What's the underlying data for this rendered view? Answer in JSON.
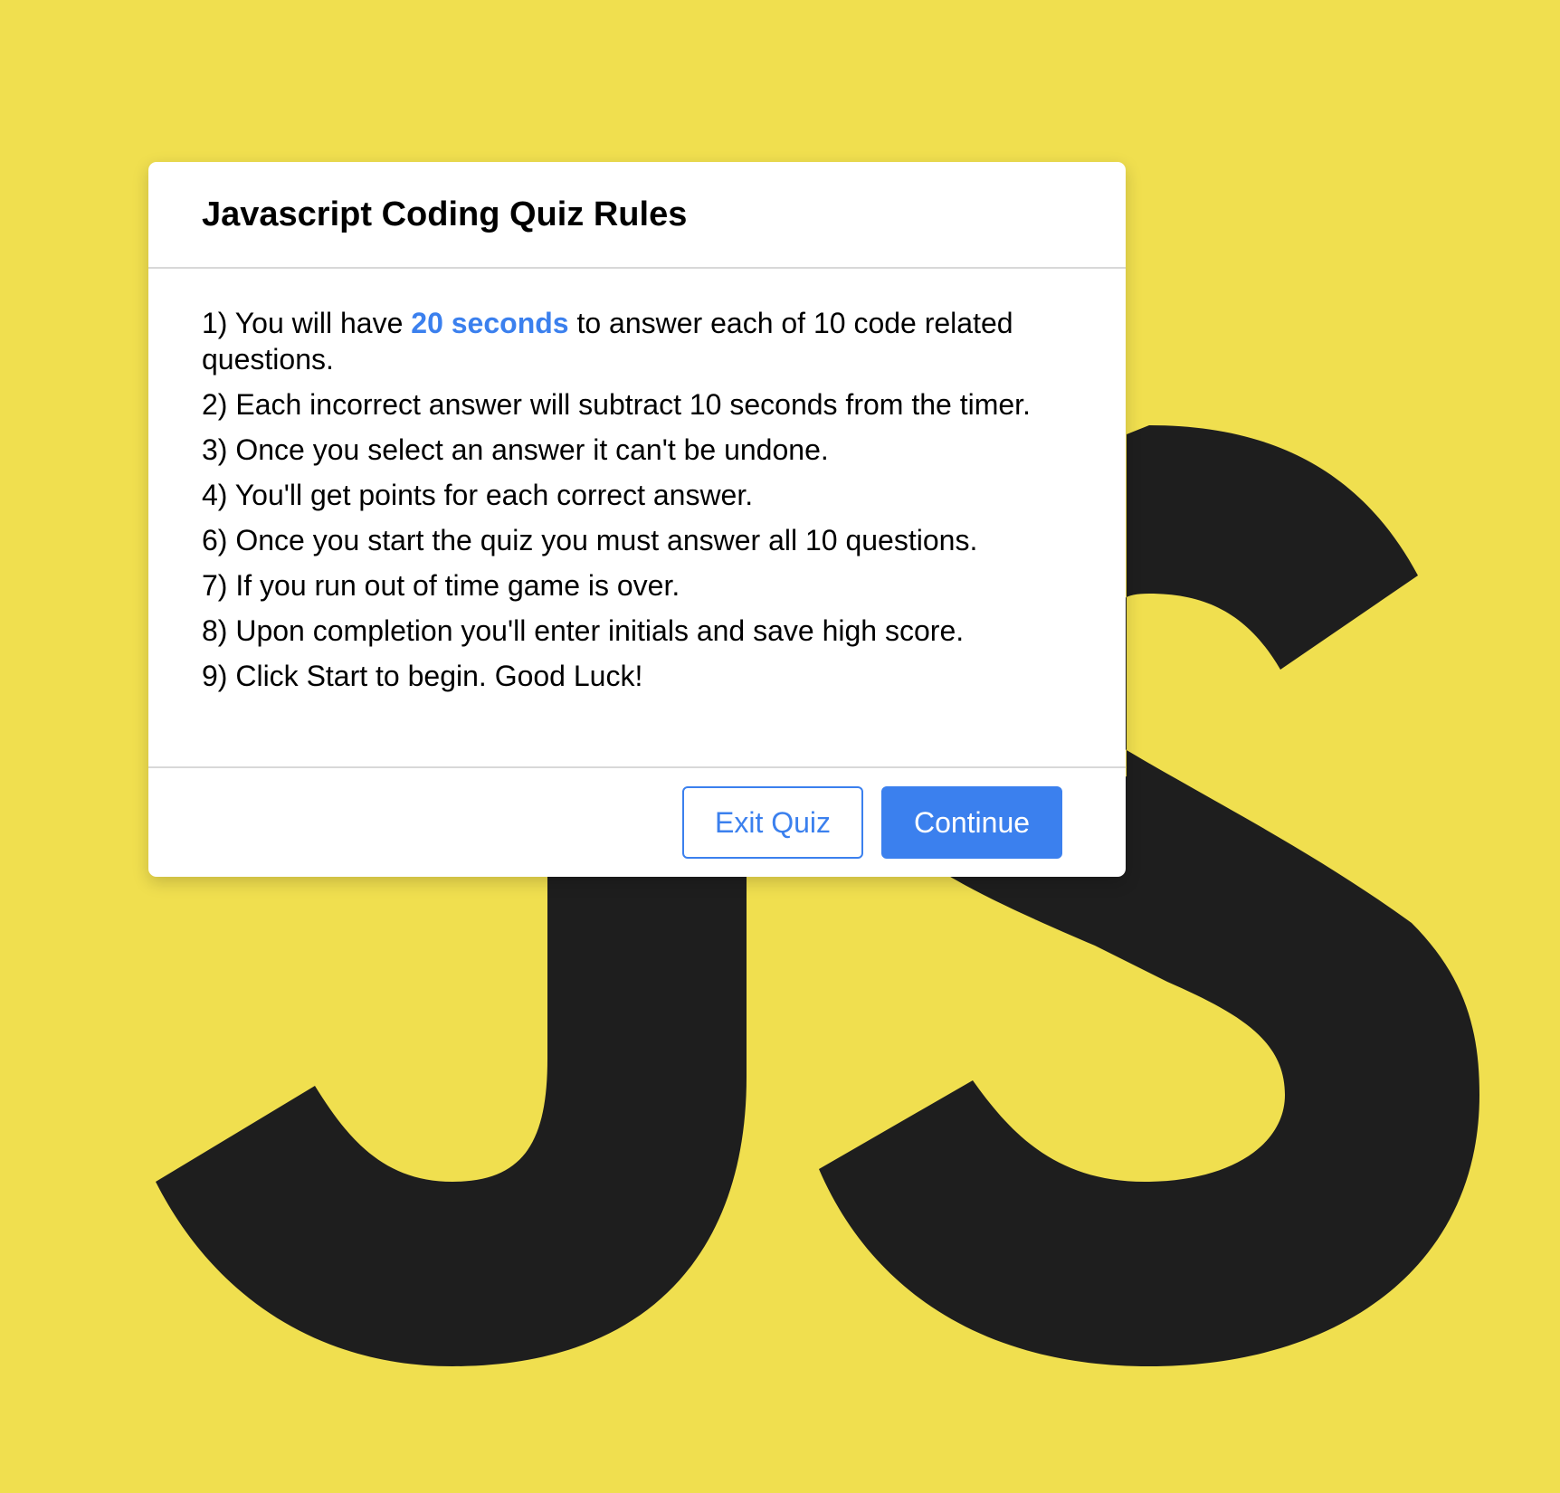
{
  "colors": {
    "background": "#f0df4f",
    "logo": "#1e1e1e",
    "accent": "#3b80ee",
    "card": "#ffffff"
  },
  "background_logo": {
    "icon": "js-logo-icon"
  },
  "modal": {
    "title": "Javascript Coding Quiz Rules",
    "rule1": {
      "prefix": "1) You will have ",
      "highlight": "20 seconds",
      "suffix": " to answer each of 10 code related questions."
    },
    "rules": [
      "2) Each incorrect answer will subtract 10 seconds from the timer.",
      "3) Once you select an answer it can't be undone.",
      "4) You'll get points for each correct answer.",
      "6) Once you start the quiz you must answer all 10 questions.",
      "7) If you run out of time game is over.",
      "8) Upon completion you'll enter initials and save high score.",
      "9) Click Start to begin. Good Luck!"
    ],
    "buttons": {
      "exit_label": "Exit Quiz",
      "continue_label": "Continue"
    }
  }
}
